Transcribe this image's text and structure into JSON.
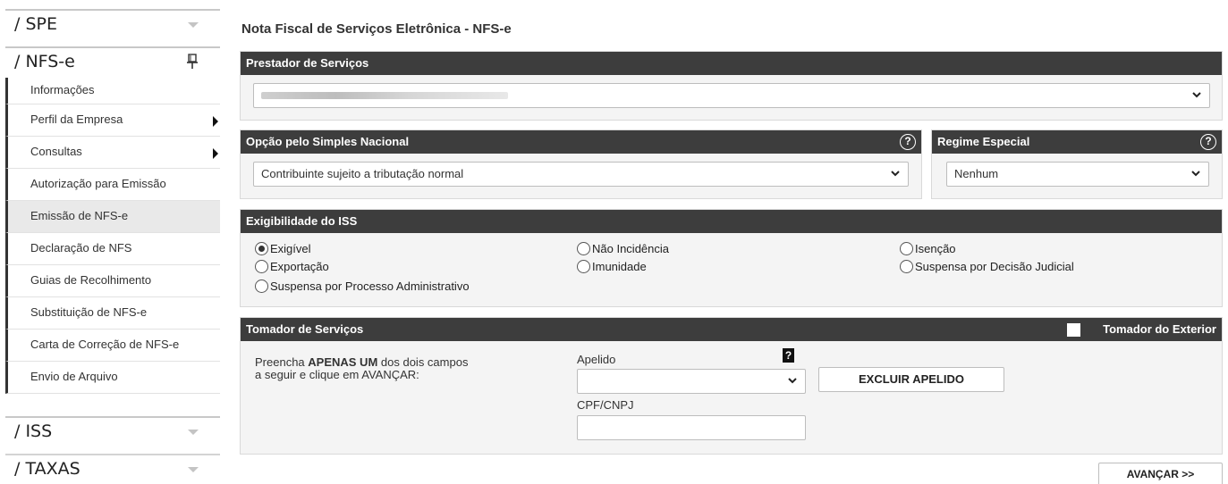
{
  "sidebar": {
    "spe_header": "/ SPE",
    "nfse_header": "/ NFS-e",
    "items": [
      {
        "label": "Informações"
      },
      {
        "label": "Perfil da Empresa"
      },
      {
        "label": "Consultas"
      },
      {
        "label": "Autorização para Emissão"
      },
      {
        "label": "Emissão de NFS-e"
      },
      {
        "label": "Declaração de NFS"
      },
      {
        "label": "Guias de Recolhimento"
      },
      {
        "label": "Substituição de NFS-e"
      },
      {
        "label": "Carta de Correção de NFS-e"
      },
      {
        "label": "Envio de Arquivo"
      }
    ],
    "iss_header": "/ ISS",
    "taxas_header": "/ TAXAS"
  },
  "main": {
    "title": "Nota Fiscal de Serviços Eletrônica - NFS-e",
    "prestador": {
      "heading": "Prestador de Serviços"
    },
    "simples": {
      "heading": "Opção pelo Simples Nacional",
      "selected": "Contribuinte sujeito a tributação normal"
    },
    "regime": {
      "heading": "Regime Especial",
      "selected": "Nenhum"
    },
    "exigibilidade": {
      "heading": "Exigibilidade do ISS",
      "options": [
        {
          "label": "Exigível",
          "checked": true
        },
        {
          "label": "Não Incidência",
          "checked": false
        },
        {
          "label": "Isenção",
          "checked": false
        },
        {
          "label": "Exportação",
          "checked": false
        },
        {
          "label": "Imunidade",
          "checked": false
        },
        {
          "label": "Suspensa por Decisão Judicial",
          "checked": false
        },
        {
          "label": "Suspensa por Processo Administrativo",
          "checked": false
        }
      ]
    },
    "tomador": {
      "heading": "Tomador de Serviços",
      "exterior_label": "Tomador do Exterior",
      "instruction_pre": "Preencha ",
      "instruction_bold": "APENAS UM",
      "instruction_post": " dos dois campos",
      "instruction_line2": "a seguir e clique em AVANÇAR:",
      "apelido_label": "Apelido",
      "apelido_help": "?",
      "excluir_button": "EXCLUIR APELIDO",
      "cpf_label": "CPF/CNPJ",
      "cpf_value": ""
    },
    "avancar_button": "AVANÇAR >>"
  }
}
